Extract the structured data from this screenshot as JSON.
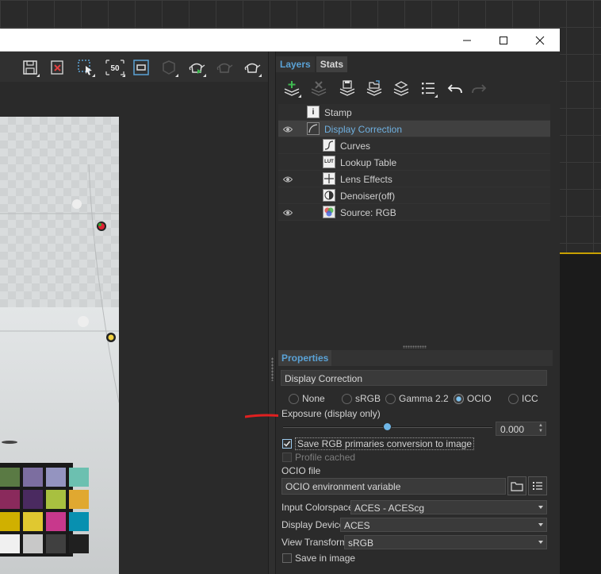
{
  "window": {
    "minimize_glyph": "—",
    "maximize_glyph": "☐",
    "close_glyph": "✕"
  },
  "left_toolbar": {
    "icons": [
      "save-icon",
      "delete-icon",
      "region-select-icon",
      "zoom-percent-icon",
      "frame-icon",
      "object-icon",
      "teapot-render-icon",
      "teapot-render-disabled-icon",
      "teapot-icon"
    ],
    "zoom_label": "50"
  },
  "render": {
    "checker_colors": [
      "#5a7a44",
      "#7c6ea0",
      "#9494c0",
      "#6cc0b0",
      "#8a2a5c",
      "#4a2a60",
      "#a8c040",
      "#e0a830",
      "#d0b000",
      "#e0c830",
      "#c8388c",
      "#0890b0",
      "#f0f0f0",
      "#c8c8c8",
      "#404040",
      "#202020"
    ]
  },
  "tabs": {
    "layers": "Layers",
    "stats": "Stats"
  },
  "layer_toolbar": {
    "icons": [
      "add-layer-icon",
      "remove-layer-icon",
      "save-layers-icon",
      "load-layers-icon",
      "save-stack-icon",
      "list-icon",
      "undo-icon",
      "redo-icon"
    ]
  },
  "layers": [
    {
      "label": "Stamp",
      "icon": "stamp-icon",
      "visible": false,
      "indent": 1,
      "selected": false
    },
    {
      "label": "Display Correction",
      "icon": "display-correction-icon",
      "visible": true,
      "indent": 1,
      "selected": true
    },
    {
      "label": "Curves",
      "icon": "curves-icon",
      "visible": false,
      "indent": 2,
      "selected": false
    },
    {
      "label": "Lookup Table",
      "icon": "lut-icon",
      "icon_text": "LUT",
      "visible": false,
      "indent": 2,
      "selected": false
    },
    {
      "label": "Lens Effects",
      "icon": "lens-effects-icon",
      "visible": true,
      "indent": 2,
      "selected": false
    },
    {
      "label": "Denoiser(off)",
      "icon": "denoiser-icon",
      "visible": false,
      "indent": 2,
      "selected": false
    },
    {
      "label": "Source: RGB",
      "icon": "source-rgb-icon",
      "visible": true,
      "indent": 2,
      "selected": false
    }
  ],
  "properties": {
    "header": "Properties",
    "title": "Display Correction",
    "modes": [
      {
        "label": "None",
        "selected": false
      },
      {
        "label": "sRGB",
        "selected": false
      },
      {
        "label": "Gamma 2.2",
        "selected": false
      },
      {
        "label": "OCIO",
        "selected": true
      },
      {
        "label": "ICC",
        "selected": false
      }
    ],
    "exposure_label": "Exposure (display only)",
    "exposure_value": "0.000",
    "exposure_slider_fraction": 0.5,
    "save_primaries_label": "Save RGB primaries conversion to image",
    "save_primaries_checked": true,
    "profile_cached_label": "Profile cached",
    "ocio_file_label": "OCIO file",
    "ocio_file_value": "OCIO environment variable",
    "input_colorspace_label": "Input Colorspace",
    "input_colorspace_value": "ACES - ACEScg",
    "display_device_label": "Display Device",
    "display_device_value": "ACES",
    "view_transform_label": "View Transform",
    "view_transform_value": "sRGB",
    "save_in_image_label": "Save in image"
  },
  "colors": {
    "accent_blue": "#5aa2d6",
    "annotation_red": "#e02020"
  }
}
